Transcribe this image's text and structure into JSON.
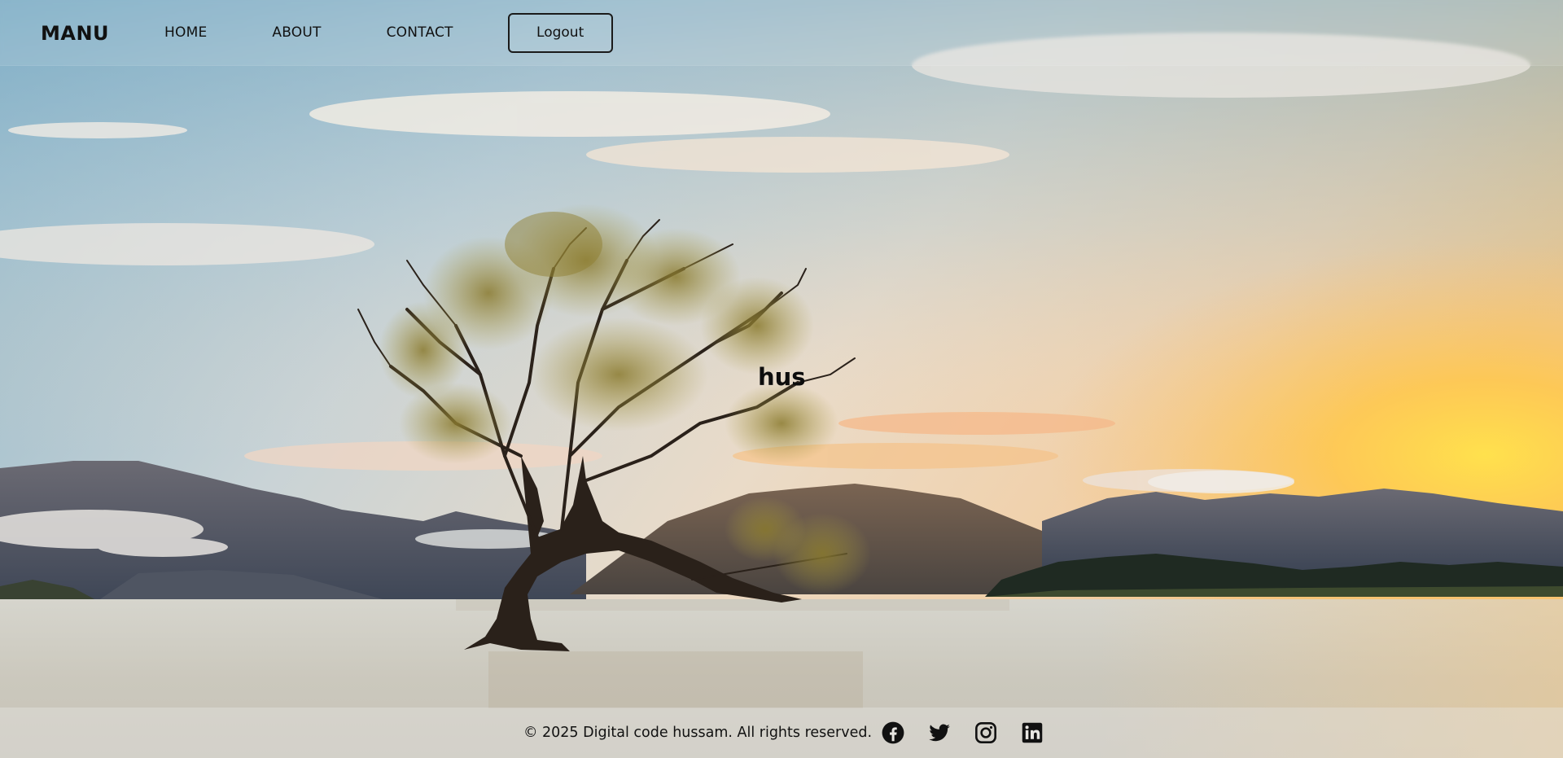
{
  "navbar": {
    "brand": "MANU",
    "links": [
      "HOME",
      "ABOUT",
      "CONTACT"
    ],
    "logout_label": "Logout"
  },
  "hero": {
    "heading": "hus"
  },
  "footer": {
    "copyright": "© 2025 Digital code hussam. All rights reserved.",
    "social_icons": [
      "facebook-icon",
      "twitter-icon",
      "instagram-icon",
      "linkedin-icon"
    ]
  },
  "colors": {
    "text": "#111111",
    "sky_top": "#7fb3cc",
    "sky_warm": "#f3d7b8",
    "sun": "#ffd24a",
    "lake": "#cfcbc0"
  }
}
